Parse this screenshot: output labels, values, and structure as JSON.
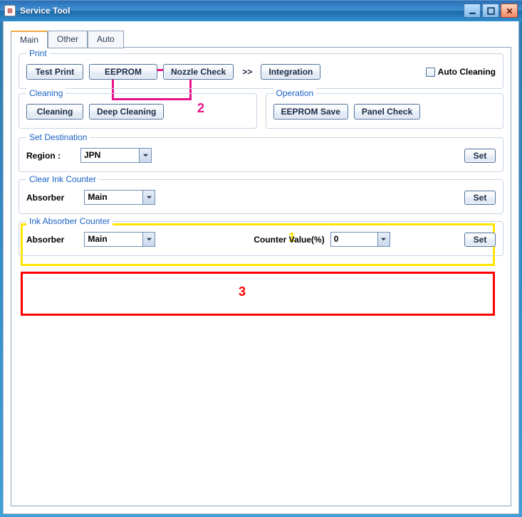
{
  "window": {
    "title": "Service Tool"
  },
  "tabs": {
    "main": "Main",
    "other": "Other",
    "auto": "Auto"
  },
  "print": {
    "legend": "Print",
    "test_print": "Test Print",
    "eeprom": "EEPROM",
    "nozzle_check": "Nozzle Check",
    "chevron": ">>",
    "integration": "Integration",
    "auto_cleaning_label": "Auto Cleaning"
  },
  "cleaning": {
    "legend": "Cleaning",
    "cleaning": "Cleaning",
    "deep_cleaning": "Deep Cleaning"
  },
  "operation": {
    "legend": "Operation",
    "eeprom_save": "EEPROM Save",
    "panel_check": "Panel Check"
  },
  "set_destination": {
    "legend": "Set Destination",
    "region_label": "Region :",
    "region_value": "JPN",
    "set_btn": "Set"
  },
  "clear_ink": {
    "legend": "Clear Ink Counter",
    "absorber_label": "Absorber",
    "absorber_value": "Main",
    "set_btn": "Set"
  },
  "ink_absorber": {
    "legend": "Ink Absorber Counter",
    "absorber_label": "Absorber",
    "absorber_value": "Main",
    "counter_label": "Counter Value(%)",
    "counter_value": "0",
    "set_btn": "Set"
  },
  "annotations": {
    "n1": "1",
    "n2": "2",
    "n3": "3"
  }
}
